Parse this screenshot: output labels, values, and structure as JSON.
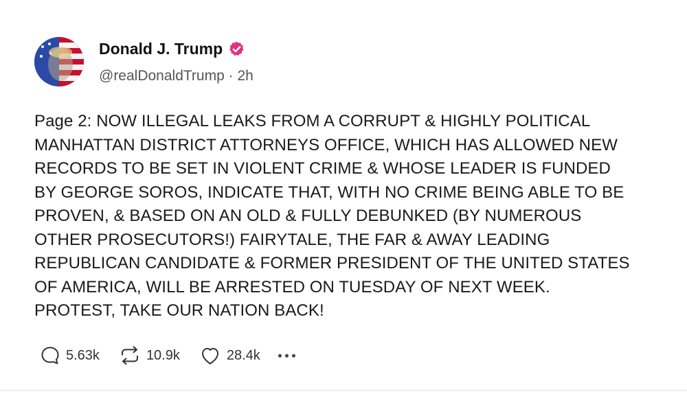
{
  "author": {
    "name": "Donald J. Trump",
    "handle": "@realDonaldTrump",
    "separator": " · ",
    "time": "2h",
    "verified_color": "#e0337f"
  },
  "post": {
    "lines": [
      "Page 2: NOW ILLEGAL LEAKS FROM A CORRUPT & HIGHLY POLITICAL",
      "MANHATTAN DISTRICT ATTORNEYS OFFICE, WHICH HAS ALLOWED NEW",
      "RECORDS TO BE SET IN VIOLENT CRIME & WHOSE LEADER IS FUNDED",
      "BY GEORGE SOROS, INDICATE THAT, WITH NO CRIME BEING ABLE TO BE",
      "PROVEN, & BASED ON AN OLD & FULLY DEBUNKED (BY NUMEROUS",
      "OTHER PROSECUTORS!) FAIRYTALE, THE FAR & AWAY LEADING",
      "REPUBLICAN CANDIDATE & FORMER PRESIDENT OF THE UNITED STATES",
      "OF AMERICA, WILL BE ARRESTED ON TUESDAY OF NEXT WEEK.",
      "PROTEST, TAKE OUR NATION BACK!"
    ]
  },
  "actions": {
    "replies": "5.63k",
    "retruths": "10.9k",
    "likes": "28.4k"
  },
  "icons": {
    "reply": "speech-bubble-icon",
    "retruth": "repost-arrows-icon",
    "like": "heart-icon",
    "more": "more-dots-icon",
    "verified": "verified-badge-icon"
  }
}
